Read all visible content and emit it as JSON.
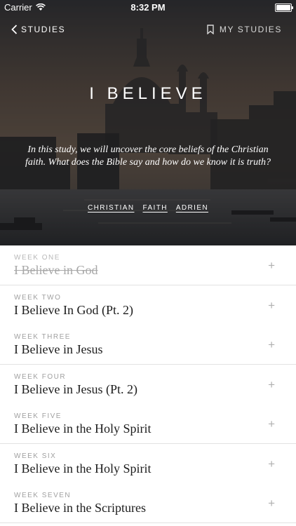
{
  "status_bar": {
    "carrier": "Carrier",
    "time": "8:32 PM",
    "icons": [
      "wifi-icon",
      "battery-icon"
    ]
  },
  "nav": {
    "back_label": "STUDIES",
    "back_icon": "chevron-left-icon",
    "my_studies_label": "MY STUDIES",
    "my_studies_icon": "bookmark-icon"
  },
  "hero": {
    "title": "I BELIEVE",
    "description": "In this study, we will uncover the core beliefs of the Christian faith.  What does the Bible say and how do we know it is truth?",
    "tags": [
      "CHRISTIAN",
      "FAITH",
      "ADRIEN"
    ]
  },
  "weeks": [
    {
      "label": "WEEK ONE",
      "title": "I Believe in God",
      "completed": true
    },
    {
      "label": "WEEK TWO",
      "title": "I Believe In God (Pt. 2)",
      "completed": false
    },
    {
      "label": "WEEK THREE",
      "title": "I Believe in Jesus",
      "completed": false
    },
    {
      "label": "WEEK FOUR",
      "title": "I Believe in Jesus (Pt. 2)",
      "completed": false
    },
    {
      "label": "WEEK FIVE",
      "title": "I Believe in the Holy Spirit",
      "completed": false
    },
    {
      "label": "WEEK SIX",
      "title": "I Believe in the Holy Spirit",
      "completed": false
    },
    {
      "label": "WEEK SEVEN",
      "title": "I Believe in the Scriptures",
      "completed": false
    }
  ],
  "expand_symbol": "+",
  "colors": {
    "text_primary": "#1c1c1c",
    "text_muted": "#a0a0a0",
    "divider": "#e2e2e2"
  }
}
